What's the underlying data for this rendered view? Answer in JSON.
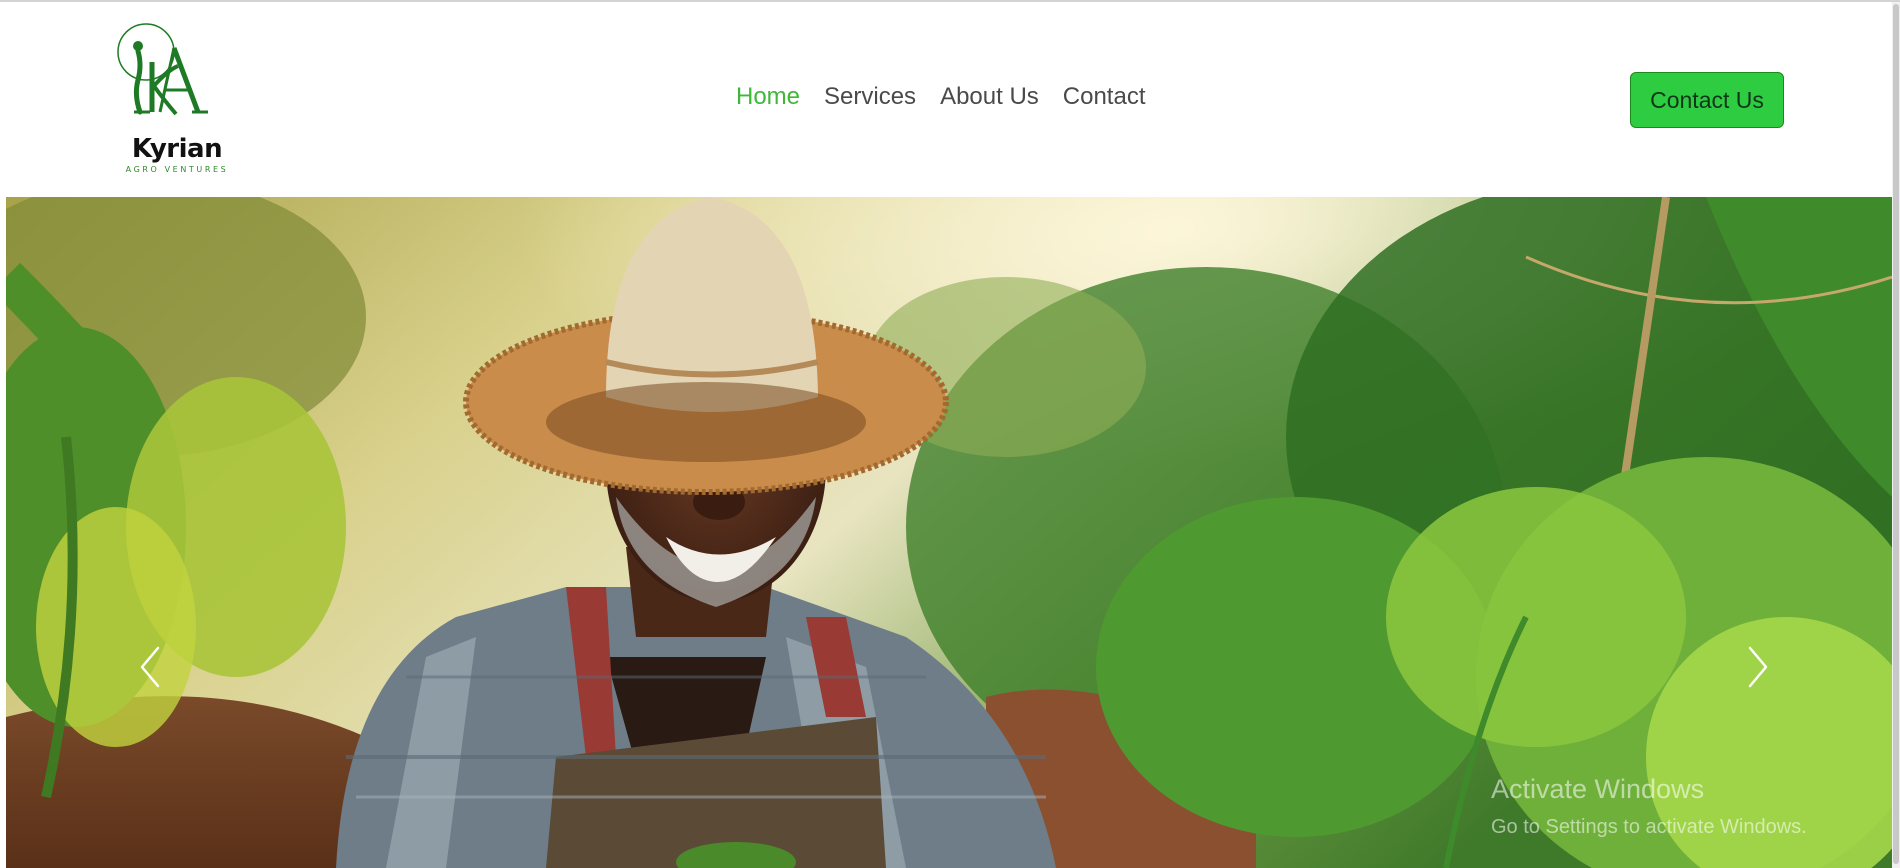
{
  "brand": {
    "name": "Kyrian",
    "tagline": "AGRO VENTURES",
    "primary_color": "#3fb83a",
    "button_color": "#2ecc40"
  },
  "nav": {
    "items": [
      {
        "label": "Home",
        "active": true
      },
      {
        "label": "Services",
        "active": false
      },
      {
        "label": "About Us",
        "active": false
      },
      {
        "label": "Contact",
        "active": false
      }
    ]
  },
  "header": {
    "cta_label": "Contact Us"
  },
  "hero": {
    "image": "smiling-farmer-in-straw-hat-in-vegetable-field",
    "prev_icon": "chevron-left-icon",
    "next_icon": "chevron-right-icon"
  },
  "watermark": {
    "title": "Activate Windows",
    "subtitle": "Go to Settings to activate Windows."
  }
}
